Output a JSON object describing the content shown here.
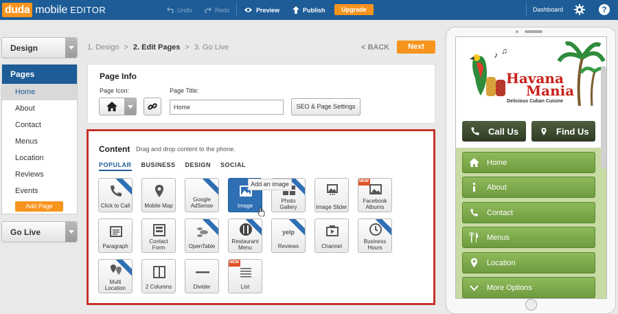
{
  "topbar": {
    "logo_duda": "duda",
    "logo_mobile": "mobile",
    "logo_editor": "EDITOR",
    "undo": "Undo",
    "redo": "Redo",
    "preview": "Preview",
    "publish": "Publish",
    "upgrade": "Upgrade",
    "dashboard": "Dashboard",
    "help": "?"
  },
  "sidebar": {
    "design": "Design",
    "pages_header": "Pages",
    "pages": [
      "Home",
      "About",
      "Contact",
      "Menus",
      "Location",
      "Reviews",
      "Events"
    ],
    "add_page": "Add Page",
    "go_live": "Go Live"
  },
  "steps": {
    "step1": "1. Design",
    "sep1": ">",
    "step2": "2. Edit Pages",
    "sep2": ">",
    "step3": "3. Go Live",
    "back": "< BACK",
    "next": "Next"
  },
  "page_info": {
    "title": "Page Info",
    "icon_label": "Page Icon:",
    "title_label": "Page Title:",
    "title_value": "Home",
    "seo_button": "SEO & Page Settings"
  },
  "content": {
    "title": "Content",
    "hint": "Drag and drop content to the phone.",
    "tabs": [
      "POPULAR",
      "BUSINESS",
      "DESIGN",
      "SOCIAL"
    ],
    "tooltip": "Add an image",
    "tiles": [
      {
        "label": "Click to Call",
        "premium": true
      },
      {
        "label": "Mobile Map"
      },
      {
        "label": "Google AdSense",
        "premium": true
      },
      {
        "label": "Image"
      },
      {
        "label": "Photo Gallery",
        "premium": true
      },
      {
        "label": "Image Slider"
      },
      {
        "label": "Facebook Albums",
        "new": true
      },
      {
        "label": "Paragraph"
      },
      {
        "label": "Contact Form"
      },
      {
        "label": "OpenTable",
        "premium": true
      },
      {
        "label": "Restaurant Menu",
        "premium": true
      },
      {
        "label": "Reviews",
        "premium": true
      },
      {
        "label": "Channel"
      },
      {
        "label": "Business Hours",
        "premium": true
      },
      {
        "label": "Multi Location",
        "premium": true
      },
      {
        "label": "2 Columns"
      },
      {
        "label": "Divider"
      },
      {
        "label": "List",
        "new": true
      }
    ],
    "new_badge": "NEW"
  },
  "phone": {
    "brand_line1": "Havana",
    "brand_line2": "Mania",
    "brand_tagline": "Delicious Cuban Cuisine",
    "call_us": "Call Us",
    "find_us": "Find Us",
    "nav": [
      "Home",
      "About",
      "Contact",
      "Menus",
      "Location",
      "More Options"
    ]
  },
  "colors": {
    "topbar": "#1d5c96",
    "accent_orange": "#f7941d",
    "highlight_border": "#c8322b",
    "nav_green": "#7aa64a"
  }
}
